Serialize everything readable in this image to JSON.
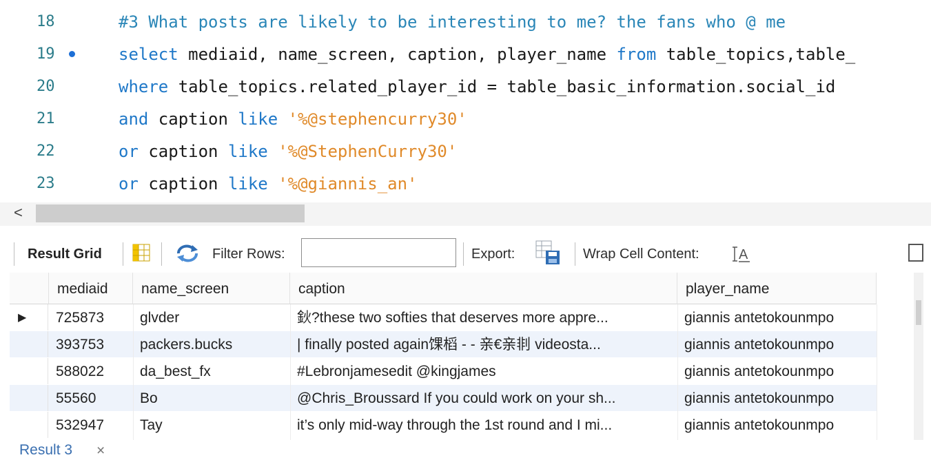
{
  "editor": {
    "lines": [
      {
        "num": "18",
        "marker": false,
        "tokens": [
          {
            "t": "#3 What posts are likely to be interesting to me? the fans who @ me",
            "c": "cmt"
          }
        ]
      },
      {
        "num": "19",
        "marker": true,
        "tokens": [
          {
            "t": "select",
            "c": "kw"
          },
          {
            "t": " mediaid, name_screen, caption, player_name ",
            "c": ""
          },
          {
            "t": "from",
            "c": "kw"
          },
          {
            "t": " table_topics,table_",
            "c": ""
          }
        ]
      },
      {
        "num": "20",
        "marker": false,
        "tokens": [
          {
            "t": "where",
            "c": "kw"
          },
          {
            "t": " table_topics.related_player_id = table_basic_information.social_id",
            "c": ""
          }
        ]
      },
      {
        "num": "21",
        "marker": false,
        "tokens": [
          {
            "t": "and",
            "c": "kw"
          },
          {
            "t": " caption ",
            "c": ""
          },
          {
            "t": "like",
            "c": "kw"
          },
          {
            "t": " ",
            "c": ""
          },
          {
            "t": "'%@stephencurry30'",
            "c": "str"
          }
        ]
      },
      {
        "num": "22",
        "marker": false,
        "tokens": [
          {
            "t": "or",
            "c": "kw"
          },
          {
            "t": " caption ",
            "c": ""
          },
          {
            "t": "like",
            "c": "kw"
          },
          {
            "t": " ",
            "c": ""
          },
          {
            "t": "'%@StephenCurry30'",
            "c": "str"
          }
        ]
      },
      {
        "num": "23",
        "marker": false,
        "tokens": [
          {
            "t": "or",
            "c": "kw"
          },
          {
            "t": " caption ",
            "c": ""
          },
          {
            "t": "like",
            "c": "kw"
          },
          {
            "t": " ",
            "c": ""
          },
          {
            "t": "'%@giannis_an'",
            "c": "str"
          }
        ]
      }
    ]
  },
  "scrollbar": {
    "left_arrow": "<"
  },
  "toolbar": {
    "result_grid_label": "Result Grid",
    "filter_rows_label": "Filter Rows:",
    "filter_rows_value": "",
    "export_label": "Export:",
    "wrap_cell_label": "Wrap Cell Content:",
    "icons": [
      "grid-view-icon",
      "refresh-icon",
      "export-icon",
      "wrap-text-icon"
    ]
  },
  "grid": {
    "columns": [
      "mediaid",
      "name_screen",
      "caption",
      "player_name"
    ],
    "rows": [
      [
        "725873",
        "glvder",
        "鈥?these two softies that deserves more appre...",
        "giannis antetokounmpo"
      ],
      [
        "393753",
        "packers.bucks",
        "| finally posted again馃槄 - - 亲€亲剕 videosta...",
        "giannis antetokounmpo"
      ],
      [
        "588022",
        "da_best_fx",
        "#Lebronjamesedit @kingjames",
        "giannis antetokounmpo"
      ],
      [
        "55560",
        "Bo",
        "@Chris_Broussard If you could work on your sh...",
        "giannis antetokounmpo"
      ],
      [
        "532947",
        "Tay",
        "it’s only mid-way through the 1st round and I mi...",
        "giannis antetokounmpo"
      ]
    ],
    "current_row_marker": "▶"
  },
  "result_tab": {
    "label": "Result 3",
    "close": "×"
  },
  "colors": {
    "keyword": "#1f78c8",
    "string": "#e08a2a",
    "comment": "#2a86b7",
    "line_number": "#2b7c8a",
    "alt_row": "#eef3fb",
    "tab_label": "#3a6fb0"
  }
}
